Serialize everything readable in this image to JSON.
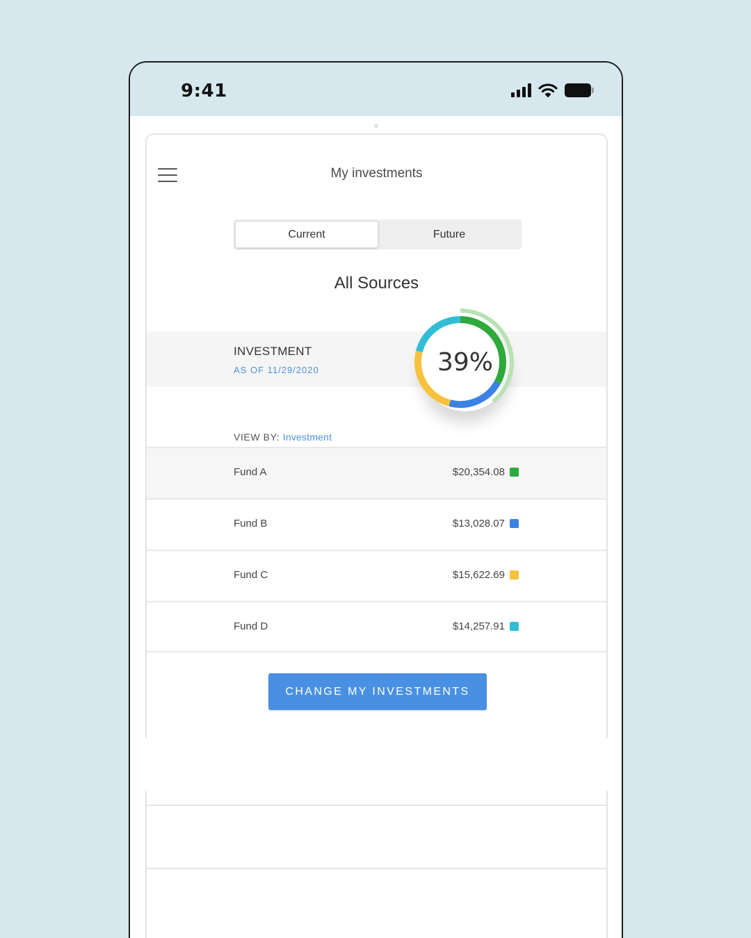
{
  "status_bar": {
    "time": "9:41"
  },
  "header": {
    "title": "My investments",
    "menu_icon": "hamburger-menu-icon"
  },
  "tabs": [
    {
      "label": "Current",
      "active": true
    },
    {
      "label": "Future",
      "active": false
    }
  ],
  "section_title": "All Sources",
  "investment": {
    "label": "INVESTMENT",
    "as_of": "AS OF 11/29/2020",
    "percent": "39%",
    "donut_segments": [
      {
        "fund": "Fund A",
        "color": "#2eaa3c",
        "fraction": 0.33
      },
      {
        "fund": "Fund B",
        "color": "#3b82e4",
        "fraction": 0.21
      },
      {
        "fund": "Fund C",
        "color": "#f6c23e",
        "fraction": 0.25
      },
      {
        "fund": "Fund D",
        "color": "#32bdd6",
        "fraction": 0.21
      }
    ],
    "donut_outer_arc": {
      "color": "#b8e2b3",
      "fraction": 0.39
    }
  },
  "view_by": {
    "label": "VIEW BY:",
    "value": "Investment"
  },
  "funds": [
    {
      "name": "Fund A",
      "value": "$20,354.08",
      "color": "#2eaa3c"
    },
    {
      "name": "Fund B",
      "value": "$13,028.07",
      "color": "#3b82e4"
    },
    {
      "name": "Fund C",
      "value": "$15,622.69",
      "color": "#f6c23e"
    },
    {
      "name": "Fund D",
      "value": "$14,257.91",
      "color": "#32bdd6"
    }
  ],
  "cta": {
    "label": "CHANGE MY INVESTMENTS",
    "color": "#4a90e2"
  }
}
